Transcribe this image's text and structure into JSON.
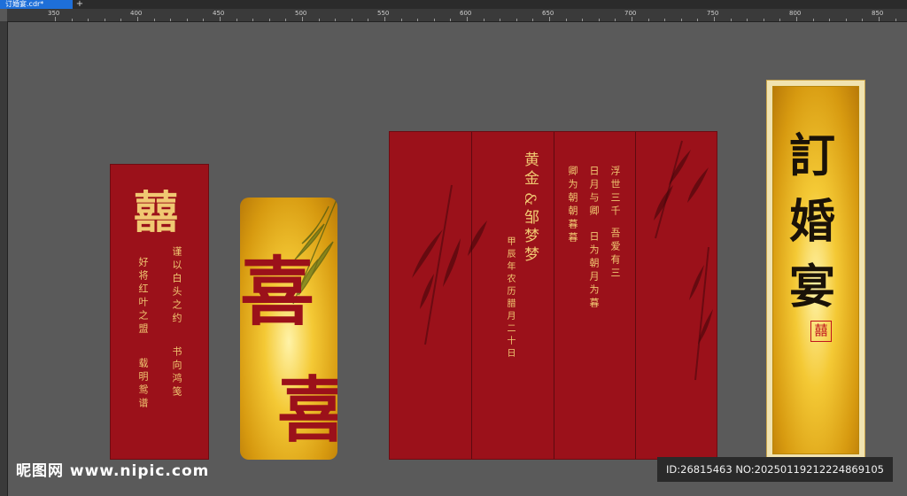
{
  "window": {
    "tab_title": "订婚宴.cdr*",
    "tab_add_icon": "+"
  },
  "ruler": {
    "ticks": [
      "350",
      "400",
      "450",
      "500",
      "550",
      "600",
      "650",
      "700",
      "750",
      "800",
      "850"
    ]
  },
  "panel1": {
    "big_char": "囍",
    "lines": [
      "谨以白头之约",
      "书向鸿笺",
      "好将红叶之盟",
      "载明鸳谱"
    ]
  },
  "panel2": {
    "char_top": "喜",
    "char_bottom": "喜"
  },
  "panel3": {
    "title_lines": [
      "黄金",
      "&邹梦梦"
    ],
    "date": "甲辰年农历腊月二十日",
    "verse_cols": [
      "卿为朝朝暮暮",
      "日月与卿",
      "日为朝月为暮",
      "浮世三千",
      "吾爱有三"
    ]
  },
  "panel4": {
    "title_chars": [
      "訂",
      "婚",
      "宴"
    ],
    "seal": "囍"
  },
  "watermark": {
    "site": "昵图网 www.nipic.com",
    "id_text": "ID:26815463 NO:20250119212224869105"
  },
  "colors": {
    "red": "#9b111a",
    "gold": "#f0c872",
    "canvas": "#585858"
  }
}
